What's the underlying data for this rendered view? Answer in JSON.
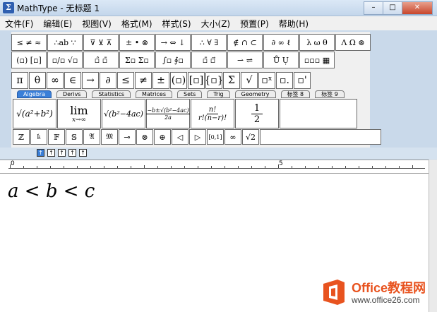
{
  "window": {
    "title": "MathType - 无标题 1",
    "app_icon": "MathType-icon",
    "buttons": [
      "–",
      "□",
      "✕"
    ]
  },
  "menubar": {
    "items": [
      "文件(F)",
      "编辑(E)",
      "视图(V)",
      "格式(M)",
      "样式(S)",
      "大小(Z)",
      "预置(P)",
      "帮助(H)"
    ]
  },
  "palettes": {
    "row1": [
      "≤ ≠ ≈",
      "∴ab ∵",
      "⊽ ⊻ ⊼",
      "± • ⊗",
      "→ ⇔ ↓",
      "∴ ∀ ∃",
      "∉ ∩ ⊂",
      "∂ ∞ ℓ",
      "λ ω θ",
      "Λ Ω ⊛"
    ],
    "row2": [
      "(▫) [▫]",
      "▫/▫ √▫",
      "▫̂ ▫̄",
      "Σ▫ Σ▫",
      "∫▫ ∮▫",
      "▫̄ ▫⃗",
      "⇀ ⇌",
      "Ů Ụ",
      "▫▫▫ ▦"
    ],
    "row3": [
      "π",
      "θ",
      "∞",
      "∈",
      "→",
      "∂",
      "≤",
      "≠",
      "±",
      "(▫)",
      "[▫]",
      "{▫}",
      "Σ",
      "√",
      "▫ˣ",
      "▫.",
      "▫'"
    ]
  },
  "tabs": [
    "Algebra",
    "Derivs",
    "Statistics",
    "Matrices",
    "Sets",
    "Trig",
    "Geometry",
    "标签 8",
    "标签 9"
  ],
  "templates": {
    "t1": "√(a²+b²)",
    "t2_top": "lim",
    "t2_bottom": "x→∞",
    "t3": "√(b²−4ac)",
    "t4_num": "−b±√(b²−4ac)",
    "t4_den": "2a",
    "t5_num": "n!",
    "t5_den": "r!(n−r)!",
    "t6_num": "1",
    "t6_den": "2"
  },
  "symbols": [
    "ℤ",
    "𝔨",
    "𝔽",
    "𝕊",
    "𝔄",
    "𝔐",
    "⊸",
    "⊗",
    "⊕",
    "◁",
    "▷",
    "[0,1]",
    "∞",
    "√2"
  ],
  "ruler": {
    "marks": [
      "0",
      "5"
    ]
  },
  "equation": {
    "text": "a < b < c"
  },
  "watermark": {
    "title": "Office教程网",
    "url": "www.office26.com"
  },
  "colors": {
    "tab_active": "#3a7fd8",
    "watermark_orange": "#e8531f"
  }
}
